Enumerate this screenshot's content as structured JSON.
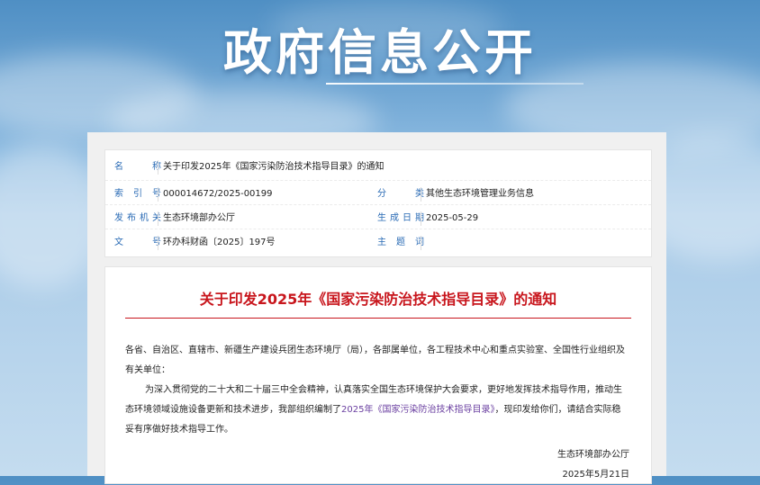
{
  "banner": {
    "title": "政府信息公开"
  },
  "meta": {
    "name_label": "名　　称",
    "name_value": "关于印发2025年《国家污染防治技术指导目录》的通知",
    "index_label": "索 引 号",
    "index_value": "000014672/2025-00199",
    "category_label": "分　　类",
    "category_value": "其他生态环境管理业务信息",
    "issuer_label": "发布机关",
    "issuer_value": "生态环境部办公厅",
    "date_label": "生成日期",
    "date_value": "2025-05-29",
    "docno_label": "文　　号",
    "docno_value": "环办科财函〔2025〕197号",
    "topic_label": "主 题 词",
    "topic_value": ""
  },
  "doc": {
    "title": "关于印发2025年《国家污染防治技术指导目录》的通知",
    "recipients": "各省、自治区、直辖市、新疆生产建设兵团生态环境厅（局），各部属单位，各工程技术中心和重点实验室、全国性行业组织及有关单位：",
    "para_before_link": "为深入贯彻党的二十大和二十届三中全会精神，认真落实全国生态环境保护大会要求，更好地发挥技术指导作用，推动生态环境领域设施设备更新和技术进步，我部组织编制了",
    "para_link": "2025年《国家污染防治技术指导目录》",
    "para_after_link": "，现印发给你们，请结合实际稳妥有序做好技术指导工作。",
    "signer": "生态环境部办公厅",
    "sign_date": "2025年5月21日"
  },
  "colors": {
    "label_blue": "#2a6bb5",
    "title_red": "#c8161d",
    "link_purple": "#6a3fa0"
  }
}
